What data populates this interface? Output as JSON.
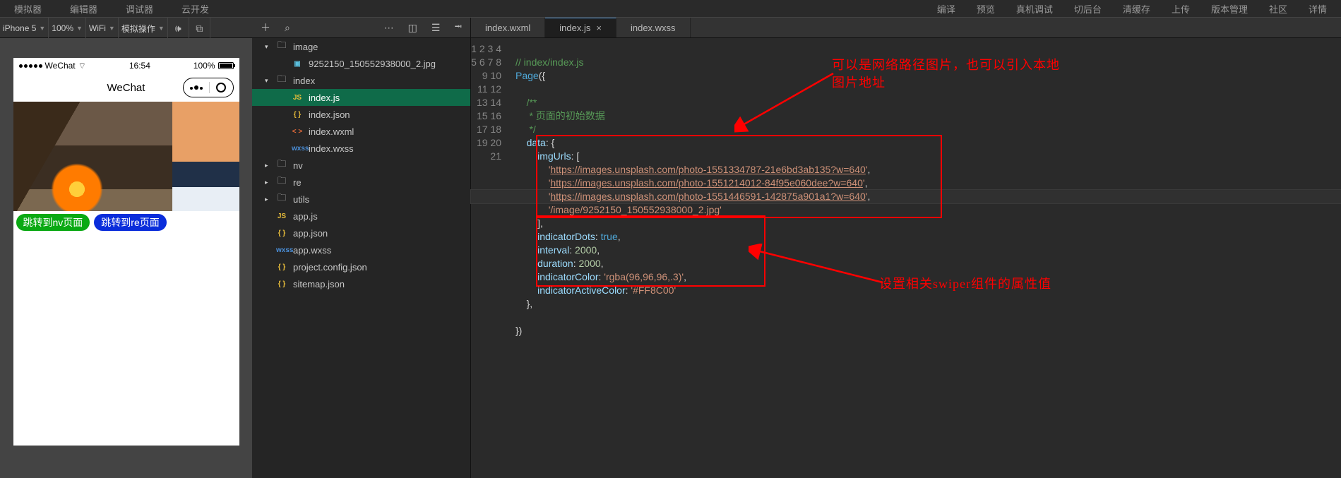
{
  "topmenu": {
    "left": [
      "模拟器",
      "编辑器",
      "调试器",
      "云开发"
    ],
    "right": [
      "编译",
      "预览",
      "真机调试",
      "切后台",
      "清缓存",
      "上传",
      "版本管理",
      "社区",
      "详情"
    ]
  },
  "simControls": {
    "device": "iPhone 5",
    "zoom": "100%",
    "network": "WiFi",
    "sim": "模拟操作"
  },
  "tabs": [
    {
      "label": "index.wxml",
      "active": false,
      "closable": false
    },
    {
      "label": "index.js",
      "active": true,
      "closable": true
    },
    {
      "label": "index.wxss",
      "active": false,
      "closable": false
    }
  ],
  "tree": [
    {
      "depth": 1,
      "kind": "folder",
      "name": "image",
      "expanded": true
    },
    {
      "depth": 2,
      "kind": "img",
      "name": "9252150_150552938000_2.jpg"
    },
    {
      "depth": 1,
      "kind": "folder",
      "name": "index",
      "expanded": true
    },
    {
      "depth": 2,
      "kind": "js",
      "name": "index.js",
      "selected": true
    },
    {
      "depth": 2,
      "kind": "json",
      "name": "index.json"
    },
    {
      "depth": 2,
      "kind": "wxml",
      "name": "index.wxml"
    },
    {
      "depth": 2,
      "kind": "wxss",
      "name": "index.wxss"
    },
    {
      "depth": 1,
      "kind": "folder",
      "name": "nv",
      "expanded": false
    },
    {
      "depth": 1,
      "kind": "folder",
      "name": "re",
      "expanded": false
    },
    {
      "depth": 1,
      "kind": "folder",
      "name": "utils",
      "expanded": false
    },
    {
      "depth": 1,
      "kind": "js",
      "name": "app.js"
    },
    {
      "depth": 1,
      "kind": "json",
      "name": "app.json"
    },
    {
      "depth": 1,
      "kind": "wxss",
      "name": "app.wxss"
    },
    {
      "depth": 1,
      "kind": "json",
      "name": "project.config.json"
    },
    {
      "depth": 1,
      "kind": "json",
      "name": "sitemap.json"
    }
  ],
  "phone": {
    "carrier": "WeChat",
    "time": "16:54",
    "battery": "100%",
    "title": "WeChat",
    "btn1": "跳转到nv页面",
    "btn2": "跳转到re页面",
    "signal": "●●●●●"
  },
  "code": {
    "lines": 21,
    "l1": "// index/index.js",
    "l2a": "Page",
    "l2b": "({",
    "l4": "/**",
    "l5": " * 页面的初始数据",
    "l6": " */",
    "l7a": "data",
    "l7b": ": {",
    "l8a": "imgUrls",
    "l8b": ": [",
    "l9": "https://images.unsplash.com/photo-1551334787-21e6bd3ab135?w=640",
    "l10": "https://images.unsplash.com/photo-1551214012-84f95e060dee?w=640",
    "l11": "https://images.unsplash.com/photo-1551446591-142875a901a1?w=640",
    "l12": "/image/9252150_150552938000_2.jpg",
    "l13": "],",
    "l14a": "indicatorDots",
    "l14b": "true",
    "l15a": "interval",
    "l15v": "2000",
    "l16a": "duration",
    "l16v": "2000",
    "l17a": "indicatorColor",
    "l17v": "rgba(96,96,96,.3)",
    "l18a": "indicatorActiveColor",
    "l18v": "#FF8C00",
    "l19": "},",
    "l21": "})"
  },
  "annotations": {
    "note1a": "可以是网络路径图片，也可以引入本地",
    "note1b": "图片地址",
    "note2": "设置相关swiper组件的属性值"
  },
  "icons": {
    "folder": "🗀",
    "img": "▣",
    "js": "JS",
    "json": "{ }",
    "wxml": "< >",
    "wxss": "wxss"
  }
}
